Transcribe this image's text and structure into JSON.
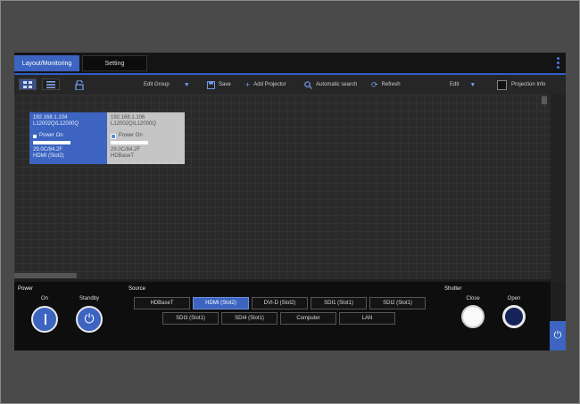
{
  "tabs": [
    {
      "label": "Layout/Monitoring",
      "active": true
    },
    {
      "label": "Setting",
      "active": false
    }
  ],
  "toolbar": {
    "edit_group": "Edit Group",
    "save": "Save",
    "add_projector": "Add Projector",
    "automatic_search": "Automatic search",
    "refresh": "Refresh",
    "edit": "Edit",
    "projection_info": "Projection Info"
  },
  "projectors": [
    {
      "ip": "192.168.1.104",
      "model": "L12002Q/L12000Q",
      "status": "Power On",
      "temp": "29.0C/84.2F",
      "input": "HDMI (Slot2)",
      "selected": true
    },
    {
      "ip": "192.168.1.106",
      "model": "L12002Q/L12000Q",
      "status": "Power On",
      "temp": "29.0C/84.2F",
      "input": "HDBaseT",
      "selected": false
    }
  ],
  "power": {
    "label": "Power",
    "on": "On",
    "standby": "Standby"
  },
  "source": {
    "label": "Source",
    "row1": [
      "HDBaseT",
      "HDMI (Slot2)",
      "DVI-D (Slot2)",
      "SDI1 (Slot1)",
      "SDI2 (Slot1)"
    ],
    "row2": [
      "SDI3 (Slot1)",
      "SDI4 (Slot1)",
      "Computer",
      "LAN"
    ],
    "selected": "HDMI (Slot2)"
  },
  "shutter": {
    "label": "Shutter",
    "close": "Close",
    "open": "Open"
  },
  "icons": [
    "grid-view-icon",
    "list-view-icon",
    "lock-icon",
    "caret-down-icon",
    "save-icon",
    "plus-icon",
    "search-icon",
    "refresh-icon",
    "power-icon",
    "kebab-menu-icon"
  ],
  "colors": {
    "accent": "#3c64c0",
    "background": "#1f1f1f",
    "page": "#4a4a4a"
  }
}
